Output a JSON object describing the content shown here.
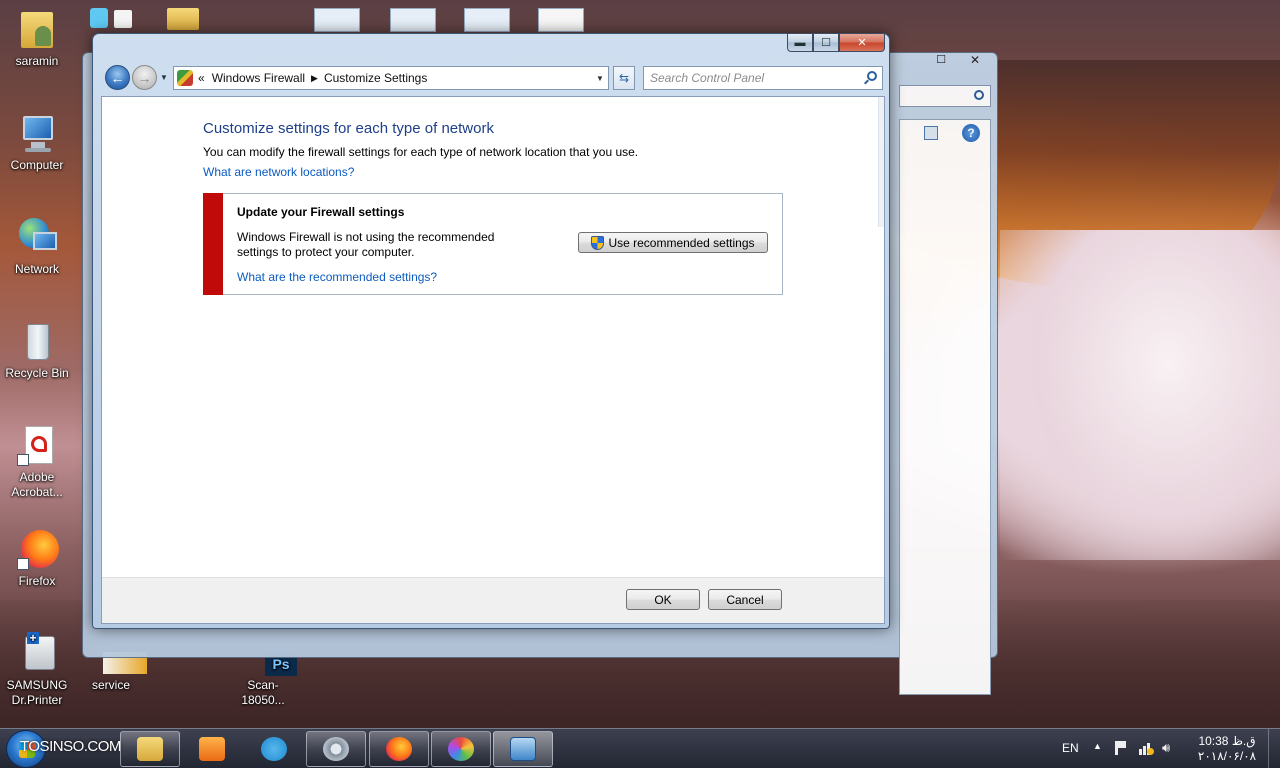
{
  "desktop": {
    "icons": [
      {
        "label": "saramin"
      },
      {
        "label": "Computer"
      },
      {
        "label": "Network"
      },
      {
        "label": "Recycle Bin"
      },
      {
        "label": "Adobe Acrobat..."
      },
      {
        "label": "Firefox"
      },
      {
        "label": "SAMSUNG Dr.Printer"
      },
      {
        "label": "service"
      },
      {
        "label": "Scan-18050..."
      }
    ]
  },
  "window": {
    "breadcrumb_prefix": "«",
    "breadcrumb": [
      "Windows Firewall",
      "Customize Settings"
    ],
    "breadcrumb_separator": "▶",
    "search_placeholder": "Search Control Panel",
    "caption": {
      "minimize": "▬",
      "maximize": "☐",
      "close": "✕"
    }
  },
  "main": {
    "title": "Customize settings for each type of network",
    "description": "You can modify the firewall settings for each type of network location that you use.",
    "network_locations_link": "What are network locations?",
    "alert": {
      "heading": "Update your Firewall settings",
      "message": "Windows Firewall is not using the recommended settings to protect your computer.",
      "link": "What are the recommended settings?",
      "button": "Use recommended settings",
      "bar_color": "#c00a0a"
    }
  },
  "footer": {
    "ok": "OK",
    "cancel": "Cancel"
  },
  "taskbar": {
    "watermark": "TOSINSO.COM",
    "language": "EN",
    "time": "10:38 ق.ظ",
    "date": "۲۰۱۸/۰۶/۰۸",
    "apps": [
      "start",
      "file-explorer",
      "media-player",
      "telegram",
      "settings",
      "firefox",
      "paint",
      "control-panel"
    ]
  },
  "colors": {
    "accent": "#1e3f8a",
    "link": "#0b5bbf",
    "alert": "#c00a0a"
  }
}
